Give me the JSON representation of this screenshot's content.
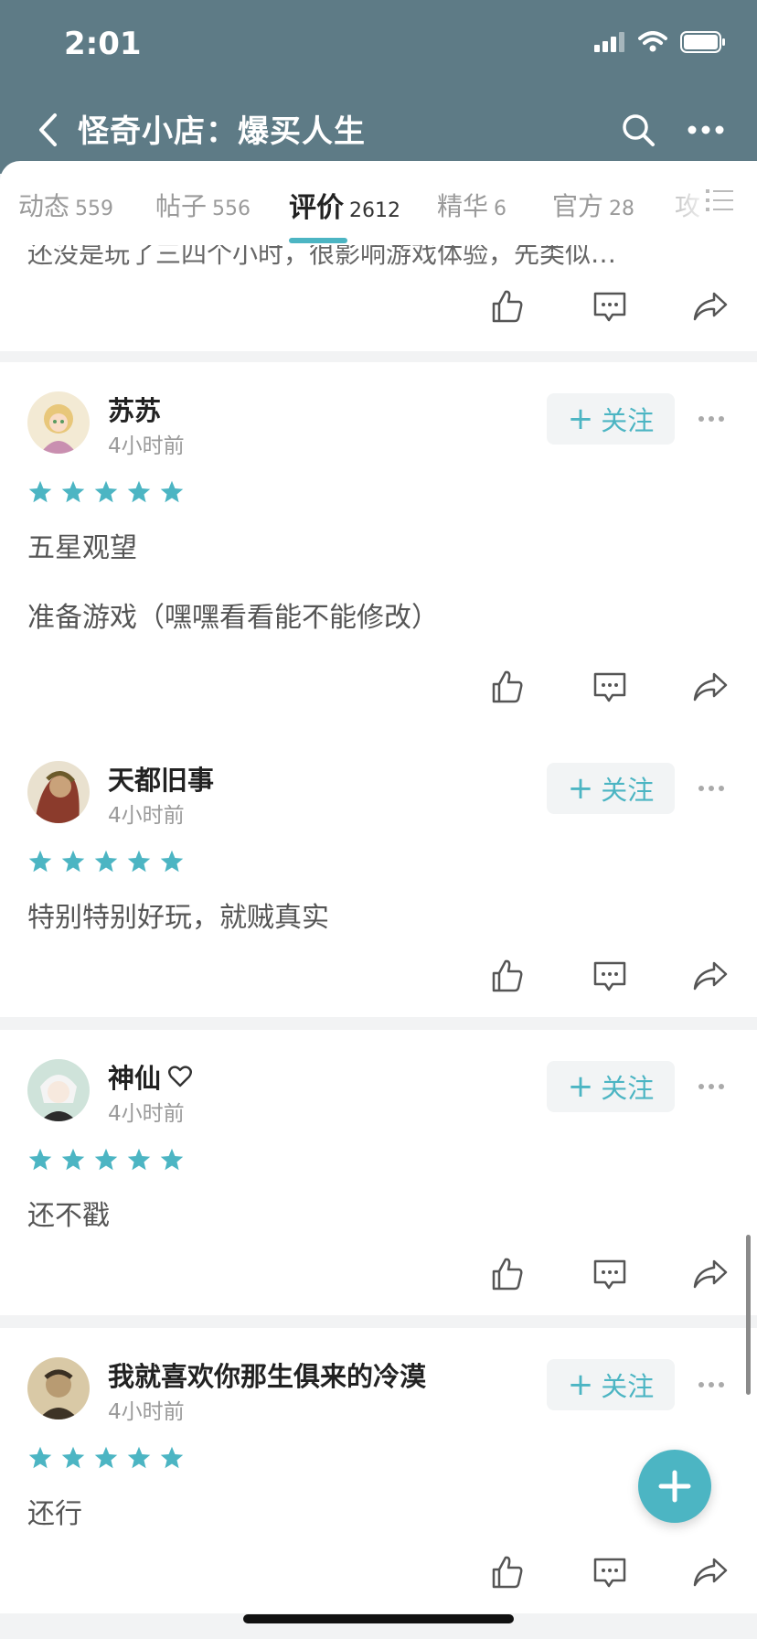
{
  "status": {
    "time": "2:01"
  },
  "header": {
    "title": "怪奇小店：爆买人生"
  },
  "tabs": [
    {
      "label": "动态",
      "count": "559"
    },
    {
      "label": "帖子",
      "count": "556"
    },
    {
      "label": "评价",
      "count": "2612",
      "active": true
    },
    {
      "label": "精华",
      "count": "6"
    },
    {
      "label": "官方",
      "count": "28"
    },
    {
      "label": "攻"
    }
  ],
  "partial_review": {
    "text": "还没是玩了三四个小时，很影响游戏体验，先类似…"
  },
  "follow_label": "关注",
  "reviews": [
    {
      "username": "苏苏",
      "time": "4小时前",
      "rating": 5,
      "lines": [
        "五星观望",
        "准备游戏（嘿嘿看看能不能修改）"
      ]
    },
    {
      "username": "天都旧事",
      "time": "4小时前",
      "rating": 5,
      "lines": [
        "特别特别好玩，就贼真实"
      ]
    },
    {
      "username": "神仙",
      "time": "4小时前",
      "rating": 5,
      "lines": [
        "还不戳"
      ],
      "badge": "heart-icon"
    },
    {
      "username": "我就喜欢你那生俱来的冷漠",
      "time": "4小时前",
      "rating": 5,
      "lines": [
        "还行"
      ]
    }
  ],
  "colors": {
    "header": "#5e7b86",
    "accent": "#4cb5c3",
    "star": "#4cb5c3"
  }
}
